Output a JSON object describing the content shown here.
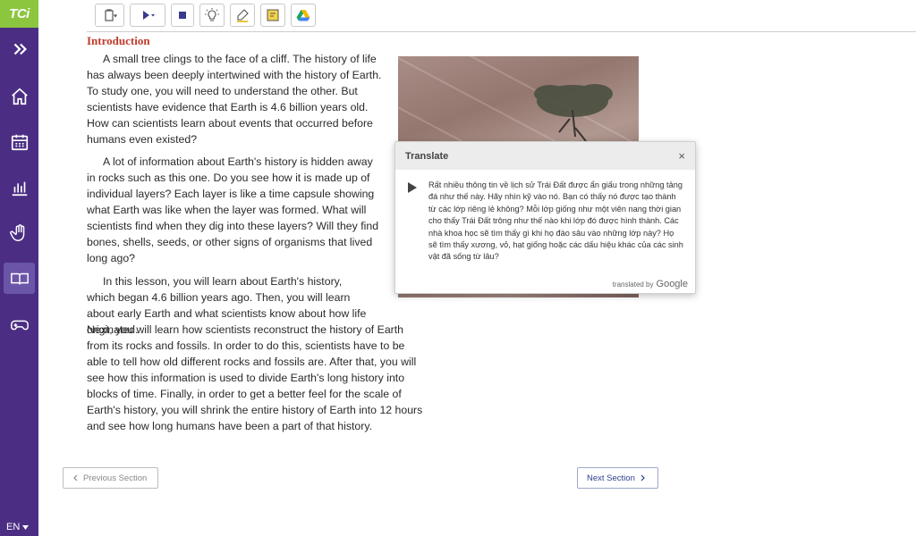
{
  "brand": {
    "logo": "TCi"
  },
  "sidebar": {
    "items": [
      {
        "icon": "chevrons-right-icon"
      },
      {
        "icon": "home-icon"
      },
      {
        "icon": "calendar-icon"
      },
      {
        "icon": "bar-chart-icon"
      },
      {
        "icon": "hand-icon"
      },
      {
        "icon": "book-icon",
        "active": true
      },
      {
        "icon": "gamepad-icon"
      }
    ],
    "language": "EN"
  },
  "toolbar": {
    "icons": [
      "clipboard-icon",
      "play-icon",
      "stop-icon",
      "lightbulb-icon",
      "highlighter-icon",
      "sticky-note-icon",
      "google-drive-icon"
    ]
  },
  "content": {
    "heading": "Introduction",
    "p1": "A small tree clings to the face of a cliff. The history of life has always been deeply intertwined with the history of Earth. To study one, you will need to understand the other. But scientists have evidence that Earth is 4.6 billion years old. How can scientists learn about events that occurred before humans even existed?",
    "p2": "A lot of information about Earth's history is hidden away in rocks such as this one. Do you see how it is made up of individual layers? Each layer is like a time capsule showing what Earth was like when the layer was formed. What will scientists find when they dig into these layers? Will they find bones, shells, seeds, or other signs of organisms that lived long ago?",
    "p3": "In this lesson, you will learn about Earth's history, which began 4.6 billion years ago. Then, you will learn about early Earth and what scientists know about how life originated.",
    "p4": "Next, you will learn how scientists reconstruct the history of Earth from its rocks and fossils. In order to do this, scientists have to be able to tell how old different rocks and fossils are. After that, you will see how this information is used to divide Earth's long history into blocks of time. Finally, in order to get a better feel for the scale of Earth's history, you will shrink the entire history of Earth into 12 hours and see how long humans have been a part of that history."
  },
  "translate": {
    "title": "Translate",
    "close": "×",
    "text": "Rất nhiều thông tin về lịch sử Trái Đất được ẩn giấu trong những tảng đá như thế này. Hãy nhìn kỹ vào nó. Bạn có thấy nó được tạo thành từ các lớp riêng lẻ không? Mỗi lớp giống như một viên nang thời gian cho thấy Trái Đất trông như thế nào khi lớp đó được hình thành. Các nhà khoa học sẽ tìm thấy gì khi họ đào sâu vào những lớp này? Họ sẽ tìm thấy xương, vỏ, hạt giống hoặc các dấu hiệu khác của các sinh vật đã sống từ lâu?",
    "credit": "translated by",
    "provider": "Google"
  },
  "nav": {
    "prev": "Previous Section",
    "next": "Next Section"
  }
}
